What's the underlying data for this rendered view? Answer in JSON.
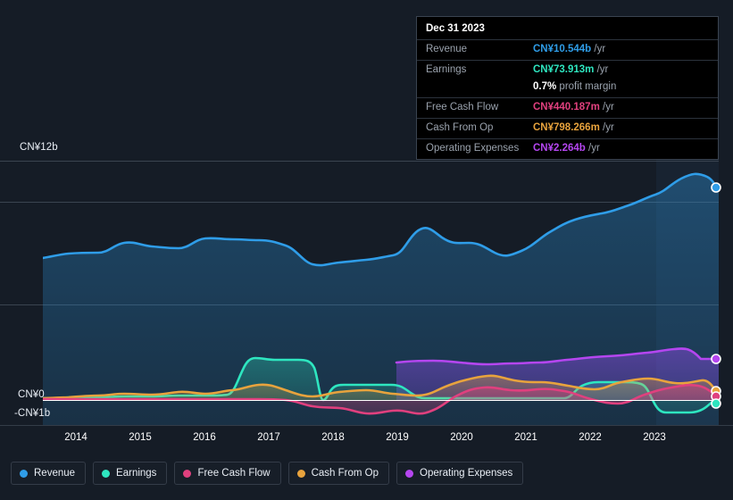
{
  "background_color": "#151c26",
  "tooltip": {
    "date": "Dec 31 2023",
    "rows": [
      {
        "key": "Revenue",
        "value": "CN¥10.544b",
        "unit": "/yr",
        "color": "#2f9de8"
      },
      {
        "key": "Earnings",
        "value": "CN¥73.913m",
        "unit": "/yr",
        "color": "#2ee6c0"
      },
      {
        "key": "",
        "value": "0.7%",
        "unit": "profit margin",
        "color": "#ffffff"
      },
      {
        "key": "Free Cash Flow",
        "value": "CN¥440.187m",
        "unit": "/yr",
        "color": "#e0407e"
      },
      {
        "key": "Cash From Op",
        "value": "CN¥798.266m",
        "unit": "/yr",
        "color": "#e8a33d"
      },
      {
        "key": "Operating Expenses",
        "value": "CN¥2.264b",
        "unit": "/yr",
        "color": "#b546f0"
      }
    ]
  },
  "axis": {
    "y_top_label": "CN¥12b",
    "y_zero_label": "CN¥0",
    "y_neg_label": "-CN¥1b",
    "x_ticks": [
      "2014",
      "2015",
      "2016",
      "2017",
      "2018",
      "2019",
      "2020",
      "2021",
      "2022",
      "2023"
    ]
  },
  "legend": [
    {
      "label": "Revenue",
      "color": "#2f9de8"
    },
    {
      "label": "Earnings",
      "color": "#2ee6c0"
    },
    {
      "label": "Free Cash Flow",
      "color": "#e0407e"
    },
    {
      "label": "Cash From Op",
      "color": "#e8a33d"
    },
    {
      "label": "Operating Expenses",
      "color": "#b546f0"
    }
  ],
  "chart_data": {
    "type": "area",
    "title": "",
    "xlabel": "",
    "ylabel": "CN¥",
    "ylim": [
      -1,
      12
    ],
    "yunit": "billions CNY",
    "grid": true,
    "legend_position": "bottom-left",
    "x_axis_range": [
      "2013.5",
      "2024.0"
    ],
    "gridline_values": [
      12,
      10,
      5,
      0
    ],
    "zero_line_value": 0,
    "forecast_divider_x": "2023.2",
    "x": [
      2013.6,
      2014,
      2014.4,
      2014.8,
      2015.2,
      2015.6,
      2016,
      2016.4,
      2016.8,
      2017.2,
      2017.6,
      2018,
      2018.4,
      2018.8,
      2019.2,
      2019.6,
      2020,
      2020.4,
      2020.8,
      2021.2,
      2021.6,
      2022,
      2022.4,
      2022.8,
      2023.2,
      2023.6,
      2024
    ],
    "series": [
      {
        "name": "Revenue",
        "color": "#2f9de8",
        "values": [
          7.2,
          7.4,
          7.5,
          7.5,
          7.9,
          7.8,
          7.9,
          8.2,
          8.2,
          8.1,
          8.0,
          7.2,
          7.1,
          7.2,
          7.4,
          8.6,
          8.2,
          8.1,
          7.7,
          8.3,
          9.1,
          9.5,
          9.7,
          9.9,
          10.5,
          11.4,
          10.544
        ]
      },
      {
        "name": "Earnings",
        "color": "#2ee6c0",
        "values": [
          0.1,
          0.1,
          0.1,
          0.15,
          0.12,
          0.2,
          0.2,
          1.2,
          2.0,
          1.85,
          1.85,
          0.0,
          1.1,
          1.15,
          1.15,
          0.1,
          0.1,
          0.1,
          0.12,
          0.12,
          1.1,
          1.1,
          0.9,
          -0.45,
          -0.5,
          -0.45,
          0.073913
        ]
      },
      {
        "name": "Free Cash Flow",
        "color": "#e0407e",
        "values": [
          0.05,
          0.05,
          0.04,
          0.06,
          0.05,
          0.05,
          0.04,
          0.05,
          0.06,
          0.05,
          0.02,
          -0.35,
          -0.38,
          -0.55,
          -0.4,
          -0.5,
          -0.3,
          0.3,
          0.45,
          0.3,
          0.35,
          0.4,
          0.1,
          -0.15,
          0.25,
          0.6,
          0.440187
        ]
      },
      {
        "name": "Cash From Op",
        "color": "#e8a33d",
        "values": [
          0.1,
          0.12,
          0.1,
          0.2,
          0.15,
          0.2,
          0.3,
          0.2,
          0.4,
          0.55,
          0.45,
          0.1,
          0.25,
          0.35,
          0.3,
          0.2,
          0.2,
          0.6,
          0.9,
          0.75,
          0.8,
          0.85,
          0.6,
          0.45,
          0.75,
          1.0,
          0.798266
        ]
      },
      {
        "name": "Operating Expenses",
        "color": "#b546f0",
        "start_x": 2019.0,
        "values": [
          null,
          null,
          null,
          null,
          null,
          null,
          null,
          null,
          null,
          null,
          null,
          null,
          null,
          null,
          1.9,
          1.95,
          1.95,
          1.93,
          1.9,
          1.92,
          1.95,
          2.0,
          2.05,
          2.1,
          2.18,
          2.25,
          2.264
        ]
      }
    ]
  }
}
